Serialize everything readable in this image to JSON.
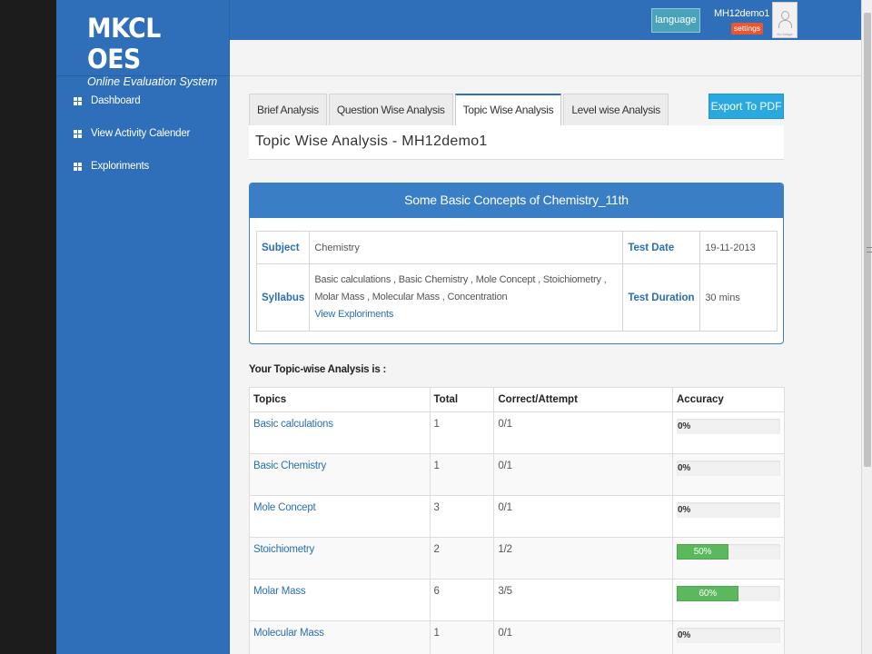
{
  "brand": {
    "logo": "MKCL OES",
    "tagline": "Online Evaluation System"
  },
  "sidebar": {
    "items": [
      {
        "label": "Dashboard",
        "icon": "grid-icon"
      },
      {
        "label": "View Activity Calender",
        "icon": "grid-icon"
      },
      {
        "label": "Exploriments",
        "icon": "grid-icon"
      }
    ]
  },
  "header": {
    "language_label": "language",
    "username": "MH12demo1",
    "settings_label": "settings",
    "avatar_text": "No Image"
  },
  "tabs": [
    {
      "label": "Brief Analysis",
      "active": false
    },
    {
      "label": "Question Wise Analysis",
      "active": false
    },
    {
      "label": "Topic Wise Analysis",
      "active": true
    },
    {
      "label": "Level wise Analysis",
      "active": false
    }
  ],
  "export_label": "Export To PDF",
  "page_title": "Topic Wise Analysis - MH12demo1",
  "test": {
    "name": "Some Basic Concepts of Chemistry_11th",
    "subject_label": "Subject",
    "subject": "Chemistry",
    "date_label": "Test Date",
    "date": "19-11-2013",
    "syllabus_label": "Syllabus",
    "syllabus": "Basic calculations , Basic Chemistry , Mole Concept , Stoichiometry , Molar Mass , Molecular Mass , Concentration",
    "view_link": "View Exploriments",
    "duration_label": "Test Duration",
    "duration": "30 mins"
  },
  "analysis": {
    "heading": "Your Topic-wise Analysis is :",
    "columns": [
      "Topics",
      "Total",
      "Correct/Attempt",
      "Accuracy"
    ],
    "rows": [
      {
        "topic": "Basic calculations",
        "total": "1",
        "correct_attempt": "0/1",
        "accuracy": "0%",
        "accuracy_value": 0
      },
      {
        "topic": "Basic Chemistry",
        "total": "1",
        "correct_attempt": "0/1",
        "accuracy": "0%",
        "accuracy_value": 0
      },
      {
        "topic": "Mole Concept",
        "total": "3",
        "correct_attempt": "0/1",
        "accuracy": "0%",
        "accuracy_value": 0
      },
      {
        "topic": "Stoichiometry",
        "total": "2",
        "correct_attempt": "1/2",
        "accuracy": "50%",
        "accuracy_value": 50
      },
      {
        "topic": "Molar Mass",
        "total": "6",
        "correct_attempt": "3/5",
        "accuracy": "60%",
        "accuracy_value": 60
      },
      {
        "topic": "Molecular Mass",
        "total": "1",
        "correct_attempt": "0/1",
        "accuracy": "0%",
        "accuracy_value": 0
      }
    ]
  },
  "colors": {
    "primary": "#2f6fb9",
    "accent": "#29a9e0",
    "success": "#5cb85c",
    "settings": "#e8572f"
  }
}
